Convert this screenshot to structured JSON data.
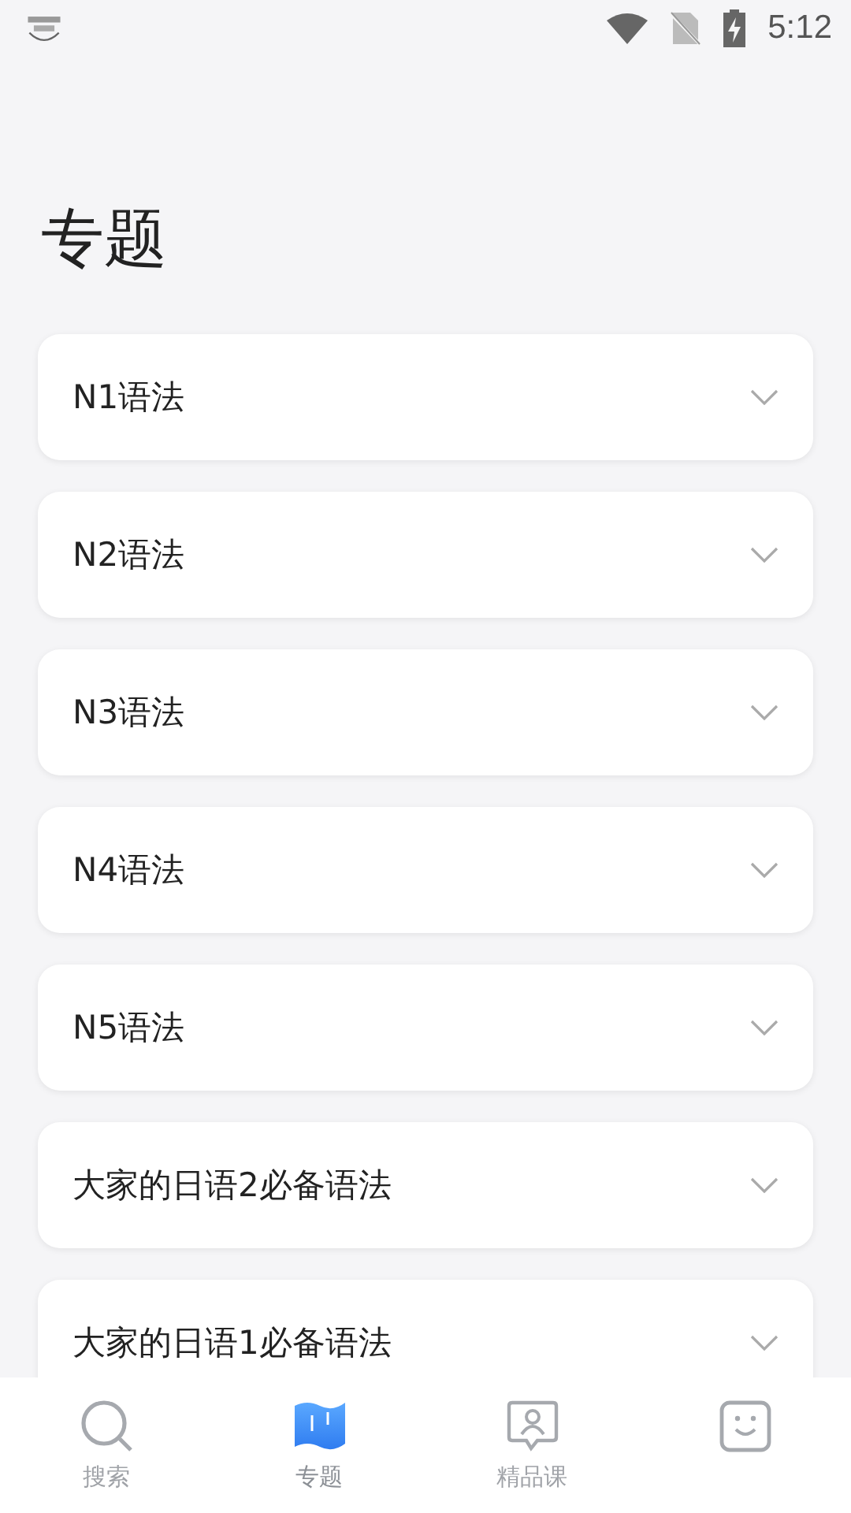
{
  "status_bar": {
    "time": "5:12"
  },
  "title": "专题",
  "topics": [
    {
      "label": "N1语法",
      "expanded": false
    },
    {
      "label": "N2语法",
      "expanded": false
    },
    {
      "label": "N3语法",
      "expanded": false
    },
    {
      "label": "N4语法",
      "expanded": false
    },
    {
      "label": "N5语法",
      "expanded": false
    },
    {
      "label": "大家的日语2必备语法",
      "expanded": false
    },
    {
      "label": "大家的日语1必备语法",
      "expanded": false
    }
  ],
  "tab_bar": [
    {
      "kind": "search",
      "label": "搜索",
      "selected": false
    },
    {
      "kind": "topics",
      "label": "专题",
      "selected": true
    },
    {
      "kind": "course",
      "label": "精品课",
      "selected": false
    },
    {
      "kind": "profile",
      "selected": false
    }
  ]
}
